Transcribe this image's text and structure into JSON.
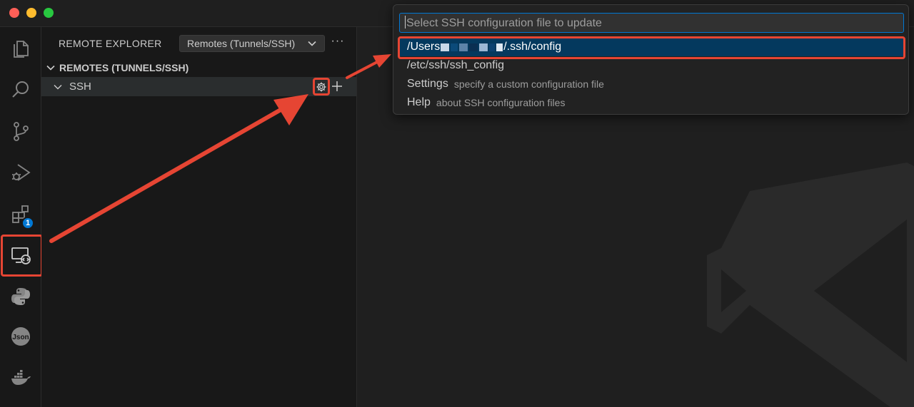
{
  "window": {
    "controls": [
      "close",
      "minimize",
      "zoom"
    ]
  },
  "activity_bar": {
    "items": [
      {
        "name": "explorer",
        "icon": "files-icon"
      },
      {
        "name": "search",
        "icon": "search-icon"
      },
      {
        "name": "source-control",
        "icon": "source-control-icon"
      },
      {
        "name": "run-debug",
        "icon": "run-debug-icon"
      },
      {
        "name": "extensions",
        "icon": "extensions-icon",
        "badge": "1"
      },
      {
        "name": "remote-explorer",
        "icon": "remote-explorer-icon",
        "active": true
      },
      {
        "name": "python",
        "icon": "python-icon"
      },
      {
        "name": "json",
        "icon": "json-icon",
        "label": "Json"
      },
      {
        "name": "docker",
        "icon": "docker-icon"
      }
    ]
  },
  "sidebar": {
    "title": "REMOTE EXPLORER",
    "selector_value": "Remotes (Tunnels/SSH)",
    "more_label": "···",
    "section_header": "REMOTES (TUNNELS/SSH)",
    "ssh_row_label": "SSH"
  },
  "quick_pick": {
    "placeholder": "Select SSH configuration file to update",
    "items": [
      {
        "label_prefix": "/Users",
        "label_suffix": "/.ssh/config",
        "description": "",
        "selected": true
      },
      {
        "label": "/etc/ssh/ssh_config",
        "description": ""
      },
      {
        "label": "Settings",
        "description": "specify a custom configuration file"
      },
      {
        "label": "Help",
        "description": "about SSH configuration files"
      }
    ]
  },
  "colors": {
    "annotation_red": "#e64533",
    "accent_blue": "#0078d4",
    "selection_bg": "#04395e"
  }
}
